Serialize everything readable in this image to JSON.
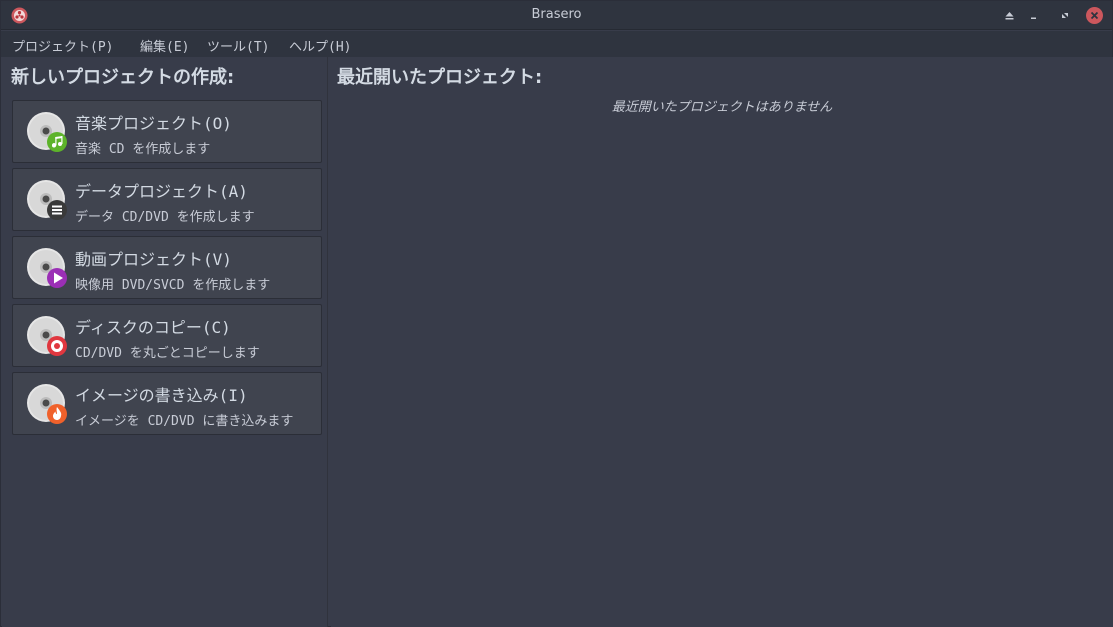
{
  "window": {
    "title": "Brasero",
    "controls": [
      "eject-icon",
      "minimize-icon",
      "restore-icon",
      "close-icon"
    ]
  },
  "menubar": {
    "items": [
      "プロジェクト(P)",
      "編集(E)",
      "ツール(T)",
      "ヘルプ(H)"
    ]
  },
  "new_project": {
    "heading": "新しいプロジェクトの作成:",
    "buttons": [
      {
        "title": "音楽プロジェクト(O)",
        "desc": "音楽 CD を作成します",
        "badge_icon": "music-note-icon",
        "badge_color": "#5db32a"
      },
      {
        "title": "データプロジェクト(A)",
        "desc": "データ CD/DVD を作成します",
        "badge_icon": "list-icon",
        "badge_color": "#3a3a3a"
      },
      {
        "title": "動画プロジェクト(V)",
        "desc": "映像用 DVD/SVCD を作成します",
        "badge_icon": "play-icon",
        "badge_color": "#9b2fb6"
      },
      {
        "title": "ディスクのコピー(C)",
        "desc": "CD/DVD を丸ごとコピーします",
        "badge_icon": "target-icon",
        "badge_color": "#e0373f"
      },
      {
        "title": "イメージの書き込み(I)",
        "desc": "イメージを CD/DVD に書き込みます",
        "badge_icon": "flame-icon",
        "badge_color": "#f0612b"
      }
    ]
  },
  "recent": {
    "heading": "最近開いたプロジェクト:",
    "empty_text": "最近開いたプロジェクトはありません"
  },
  "colors": {
    "background": "#383c4a",
    "titlebar": "#2f343f",
    "button": "#40444f",
    "text": "#d3dae3",
    "close": "#cc575d"
  }
}
